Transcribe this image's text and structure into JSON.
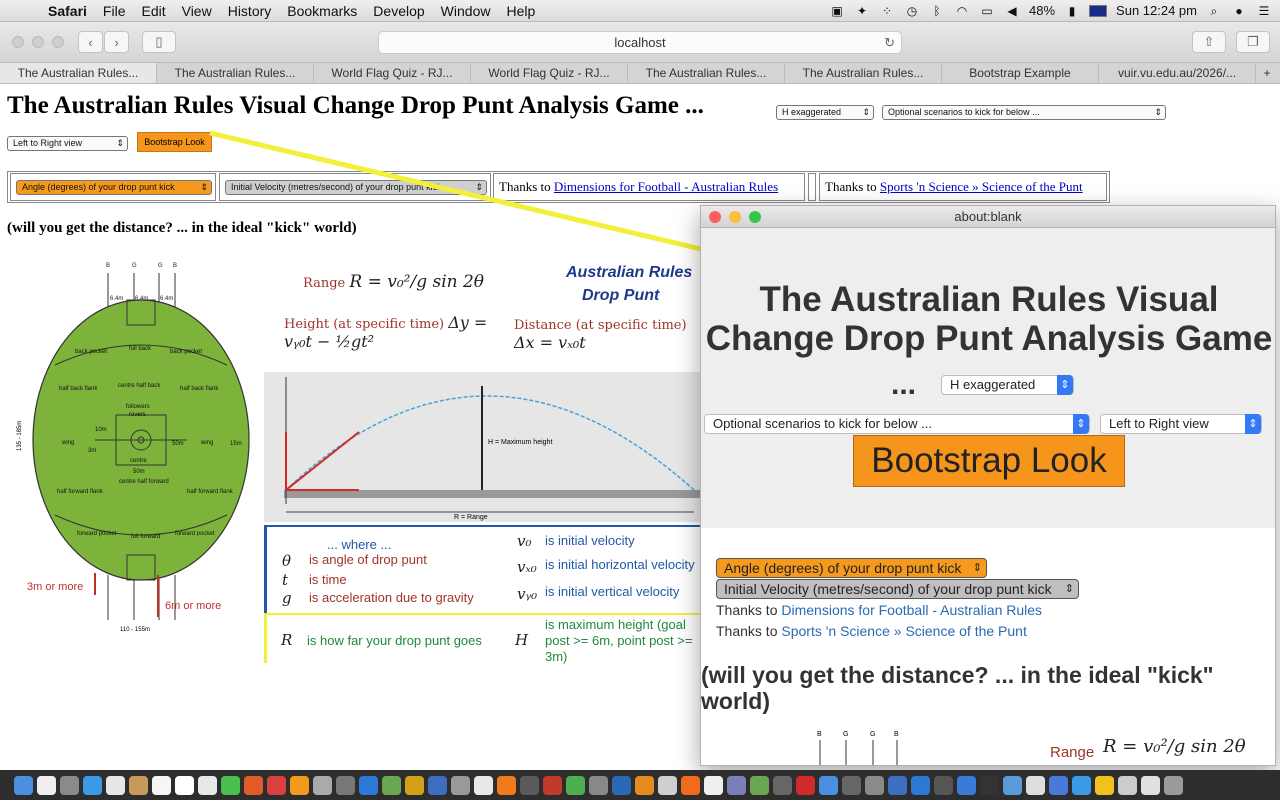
{
  "menubar": {
    "app": "Safari",
    "menus": [
      "File",
      "Edit",
      "View",
      "History",
      "Bookmarks",
      "Develop",
      "Window",
      "Help"
    ],
    "battery": "48%",
    "clock": "Sun 12:24 pm"
  },
  "toolbar": {
    "url": "localhost"
  },
  "tabs": [
    "The Australian Rules...",
    "The Australian Rules...",
    "World Flag Quiz - RJ...",
    "World Flag Quiz - RJ...",
    "The Australian Rules...",
    "The Australian Rules...",
    "Bootstrap Example",
    "vuir.vu.edu.au/2026/..."
  ],
  "page": {
    "title": "The Australian Rules Visual Change Drop Punt Analysis Game ...",
    "h_select": "H exaggerated",
    "scenario_select": "Optional scenarios to kick for below ...",
    "view_select": "Left to Right view",
    "bootstrap_button": "Bootstrap Look",
    "angle_select": "Angle (degrees) of your drop punt kick",
    "velocity_select": "Initial Velocity (metres/second) of your drop punt kick",
    "thanks_prefix": "Thanks to",
    "thanks1_link": "Dimensions for Football - Australian Rules",
    "thanks2_link": "Sports 'n Science » Science of the Punt",
    "subtitle": "(will you get the distance? ... in the ideal \"kick\" world)"
  },
  "figure": {
    "range_label": "Range",
    "height_label": "Height (at specific time)",
    "distance_label": "Distance (at specific time)",
    "brand_line1": "Australian Rules",
    "brand_line2": "Drop Punt",
    "max_height_label": "H = Maximum height",
    "range_axis": "R = Range",
    "where": "... where ...",
    "legend": [
      {
        "sym": "θ",
        "text": "is angle of drop punt"
      },
      {
        "sym": "t",
        "text": "is time"
      },
      {
        "sym": "g",
        "text": "is acceleration due to gravity"
      }
    ],
    "legend_right": [
      {
        "sym": "v₀",
        "text": "is initial velocity"
      },
      {
        "sym": "vₓ₀",
        "text": "is initial horizontal velocity"
      },
      {
        "sym": "vᵧ₀",
        "text": "is initial vertical velocity"
      }
    ],
    "r_text": "is how far your drop punt goes",
    "h_text": "is maximum height (goal post >= 6m, point post >= 3m)",
    "field": {
      "top_labels": [
        "B",
        "G",
        "G",
        "B"
      ],
      "post_widths": [
        "6.4m",
        "6.4m",
        "6.4m"
      ],
      "zones": [
        "back pocket",
        "full back",
        "back pocket",
        "half back flank",
        "centre half back",
        "half back flank",
        "followers",
        "rovers",
        "10m",
        "wing",
        "centre",
        "wing",
        "50m",
        "15m",
        "3m",
        "50m",
        "half forward flank",
        "centre half forward",
        "half forward flank",
        "forward pocket",
        "full forward",
        "forward pocket"
      ],
      "side_length": "135 - 185m",
      "width": "110 - 155m",
      "post_min_left": "3m or more",
      "post_min_right": "6m or more"
    }
  },
  "popup": {
    "window_title": "about:blank",
    "title": "The Australian Rules Visual Change Drop Punt Analysis Game",
    "ellipsis": "...",
    "h_select": "H exaggerated",
    "scenario_select": "Optional scenarios to kick for below ...",
    "view_select": "Left to Right view",
    "bootstrap_button": "Bootstrap Look",
    "angle_select": "Angle (degrees) of your drop punt kick",
    "velocity_select": "Initial Velocity (metres/second) of your drop punt kick",
    "thanks_prefix": "Thanks to",
    "thanks1_link": "Dimensions for Football - Australian Rules",
    "thanks2_link": "Sports 'n Science » Science of the Punt",
    "subtitle": "(will you get the distance? ... in the ideal \"kick\" world)",
    "range_label": "Range"
  },
  "colors": {
    "orange": "#f5951c",
    "field_green": "#7db33a",
    "arrow_yellow": "#f4ef3a",
    "link_blue": "#0000cc"
  }
}
